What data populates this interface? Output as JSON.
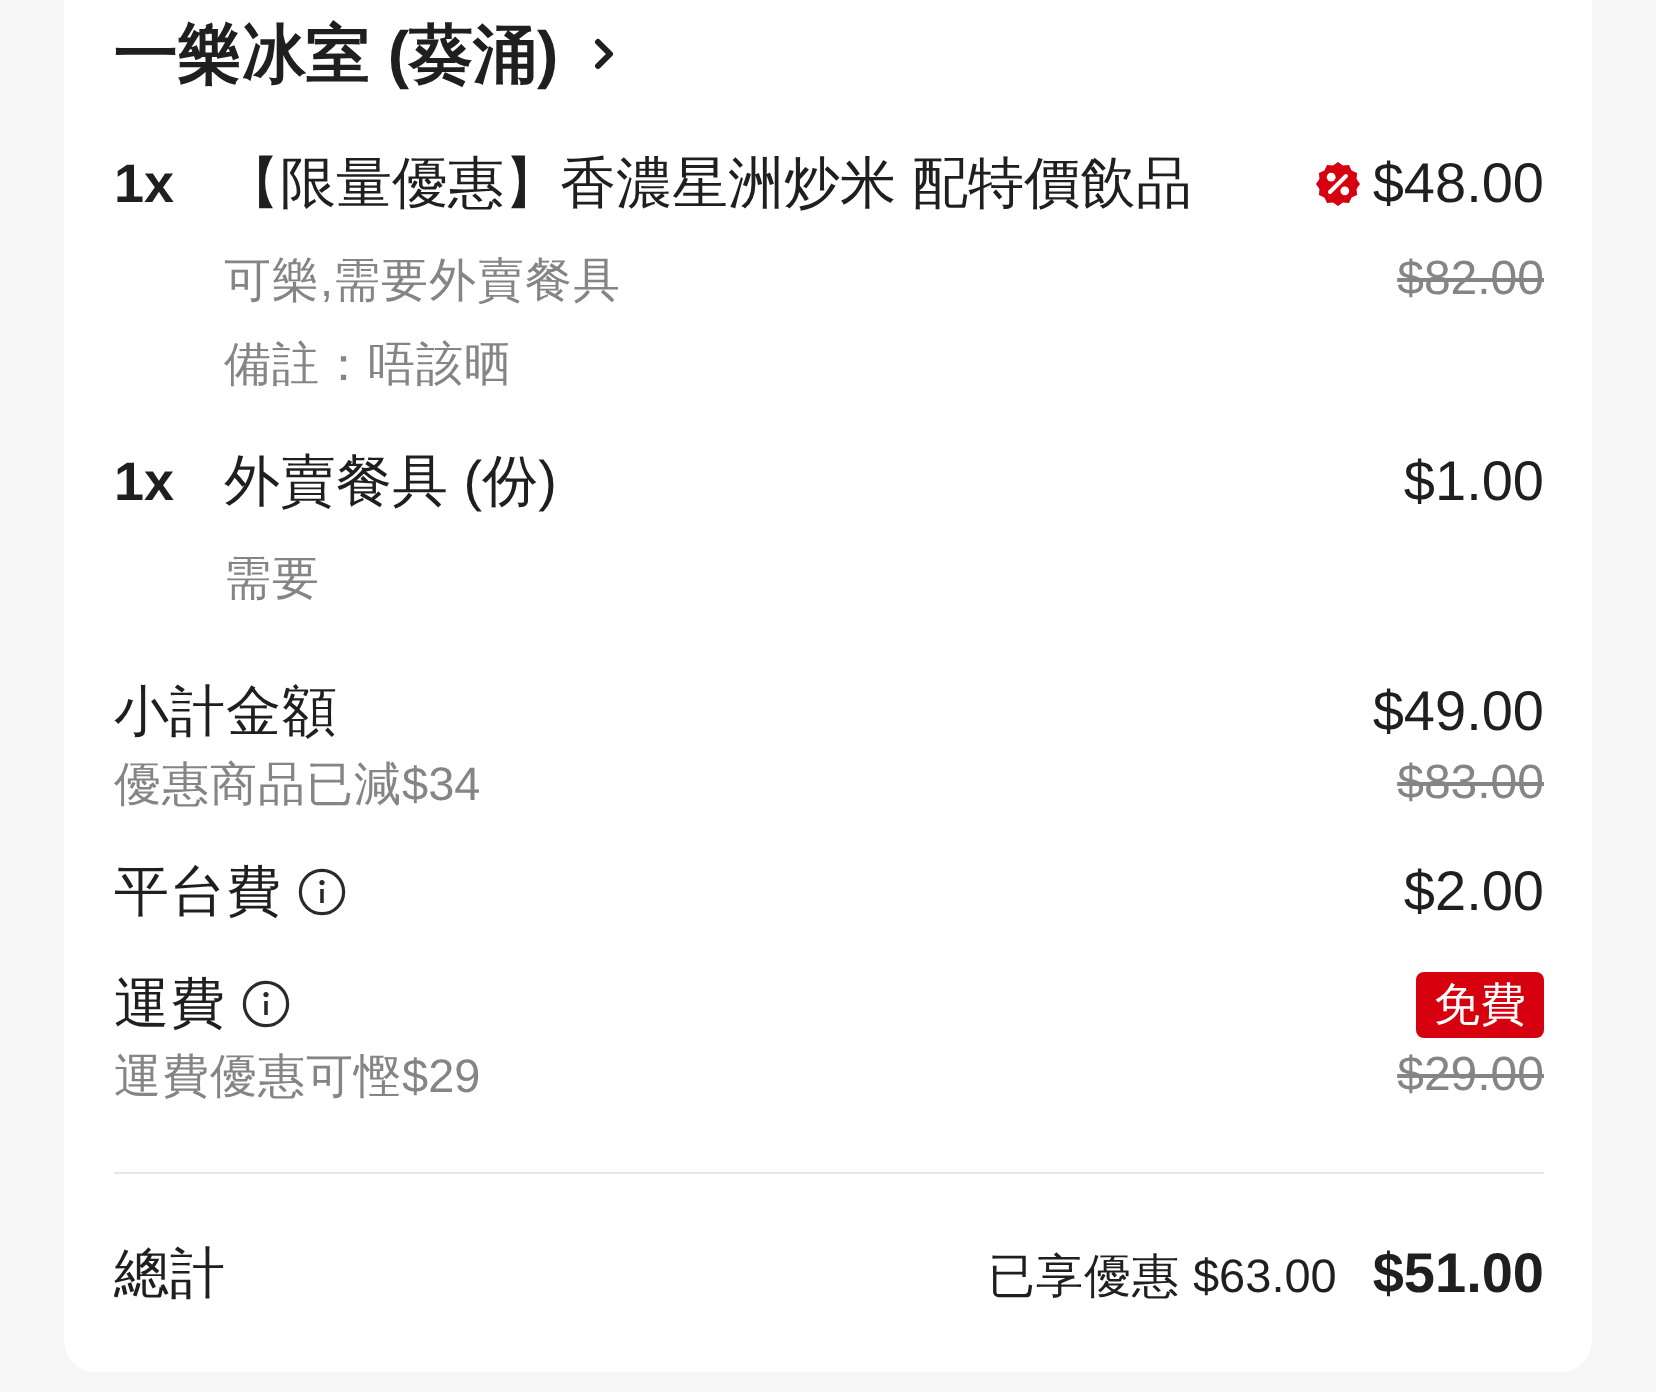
{
  "restaurant": {
    "name": "一樂冰室 (葵涌)"
  },
  "items": [
    {
      "quantity": "1x",
      "name": "【限量優惠】香濃星洲炒米 配特價飲品",
      "discounted": true,
      "price": "$48.00",
      "original_price": "$82.00",
      "details": [
        "可樂,需要外賣餐具",
        "備註：唔該晒"
      ]
    },
    {
      "quantity": "1x",
      "name": "外賣餐具 (份)",
      "discounted": false,
      "price": "$1.00",
      "details": [
        "需要"
      ]
    }
  ],
  "summary": [
    {
      "kind": "amount",
      "label": "小計金額",
      "info": false,
      "note": "優惠商品已減$34",
      "value": "$49.00",
      "original_value": "$83.00"
    },
    {
      "kind": "amount",
      "label": "平台費",
      "info": true,
      "value": "$2.00"
    },
    {
      "kind": "badge",
      "label": "運費",
      "info": true,
      "note": "運費優惠可慳$29",
      "value": "免費",
      "original_value": "$29.00"
    }
  ],
  "total": {
    "label": "總計",
    "savings": "已享優惠 $63.00",
    "value": "$51.00"
  }
}
